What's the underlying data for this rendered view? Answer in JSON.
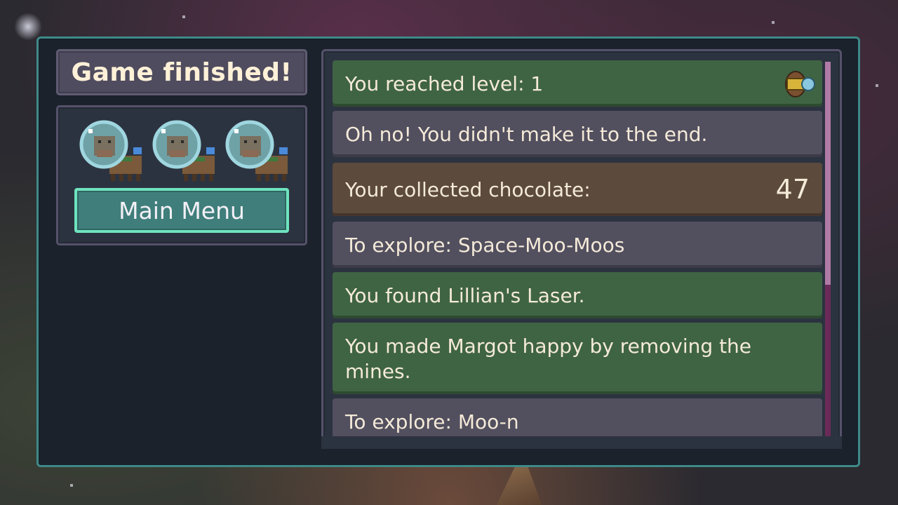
{
  "screen": {
    "title": "Game finished!",
    "main_menu_label": "Main Menu",
    "lives_remaining": 3
  },
  "results": [
    {
      "text": "You reached level:  1",
      "style": "green",
      "icon": "level-badge-icon"
    },
    {
      "text": "Oh no! You didn't make it to the end.",
      "style": "gray"
    },
    {
      "text": "Your collected chocolate:",
      "value": "47",
      "style": "brown"
    },
    {
      "text": "To explore: Space-Moo-Moos",
      "style": "gray"
    },
    {
      "text": "You found Lillian's Laser.",
      "style": "green"
    },
    {
      "text": "You made Margot happy by removing the mines.",
      "style": "green"
    },
    {
      "text": "To explore: Moo-n",
      "style": "gray"
    }
  ],
  "colors": {
    "panel_border": "#3e8a88",
    "button_border": "#6ee3be",
    "green_row": "#3f6443",
    "gray_row": "#524f5f",
    "brown_row": "#5c4a3c",
    "scrollbar": "#b07aa6"
  }
}
